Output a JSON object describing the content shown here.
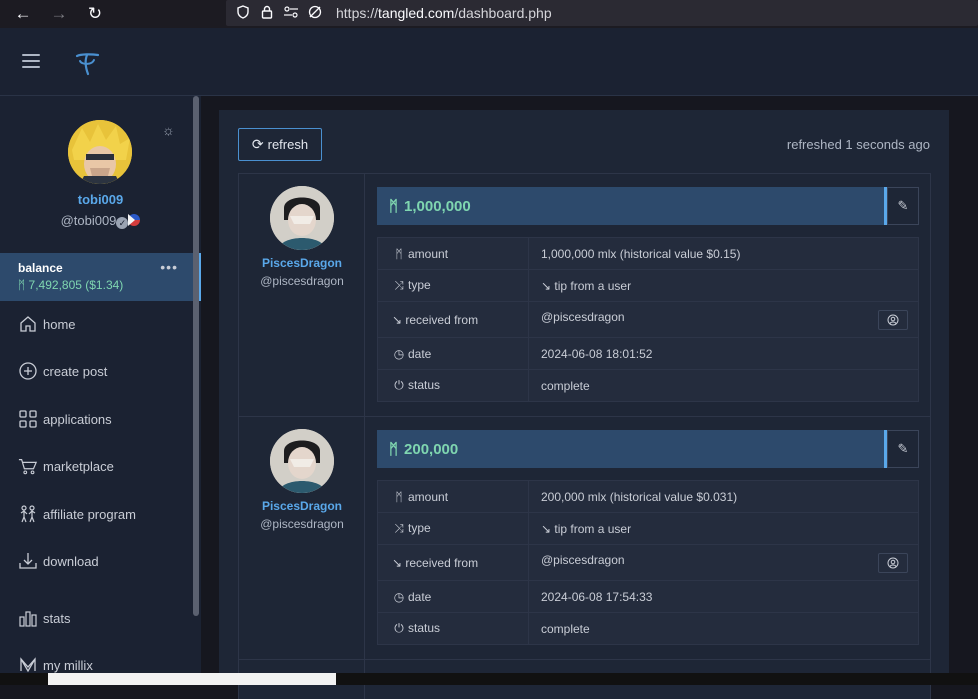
{
  "browser": {
    "url_scheme": "https://",
    "url_host": "tangled.com",
    "url_path": "/dashboard.php"
  },
  "profile": {
    "username": "tobi009",
    "handle": "@tobi009"
  },
  "balance": {
    "label": "balance",
    "value": "7,492,805 ($1.34)"
  },
  "menu": [
    {
      "label": "home",
      "icon": "home-icon"
    },
    {
      "label": "create post",
      "icon": "plus-circle-icon"
    },
    {
      "label": "applications",
      "icon": "grid-icon"
    },
    {
      "label": "marketplace",
      "icon": "cart-icon"
    },
    {
      "label": "affiliate program",
      "icon": "people-icon"
    },
    {
      "label": "download",
      "icon": "download-icon"
    },
    {
      "label": "stats",
      "icon": "bar-chart-icon"
    },
    {
      "label": "my millix",
      "icon": "millix-icon"
    }
  ],
  "main": {
    "refresh_label": "refresh",
    "refreshed_text": "refreshed 1 seconds ago"
  },
  "transactions": [
    {
      "sender_name": "PiscesDragon",
      "sender_handle": "@piscesdragon",
      "amount_header": "1,000,000",
      "rows": {
        "amount_label": "amount",
        "amount_value": "1,000,000 mlx (historical value $0.15)",
        "type_label": "type",
        "type_value": "↘ tip from a user",
        "received_label": "↘ received from",
        "received_value": "@piscesdragon",
        "date_label": "date",
        "date_value": "2024-06-08 18:01:52",
        "status_label": "status",
        "status_value": "complete"
      }
    },
    {
      "sender_name": "PiscesDragon",
      "sender_handle": "@piscesdragon",
      "amount_header": "200,000",
      "rows": {
        "amount_label": "amount",
        "amount_value": "200,000 mlx (historical value $0.031)",
        "type_label": "type",
        "type_value": "↘ tip from a user",
        "received_label": "↘ received from",
        "received_value": "@piscesdragon",
        "date_label": "date",
        "date_value": "2024-06-08 17:54:33",
        "status_label": "status",
        "status_value": "complete"
      }
    }
  ],
  "colors": {
    "accent": "#5aa8ea",
    "mlx_green": "#7fd6b0",
    "panel": "#1b2232"
  }
}
